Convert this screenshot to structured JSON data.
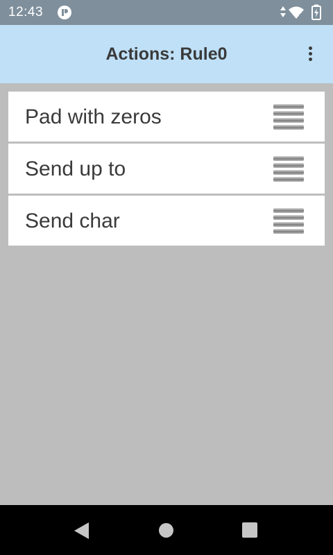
{
  "status_bar": {
    "time": "12:43",
    "icons": [
      "app-notification-icon",
      "data-arrows-icon",
      "wifi-icon",
      "battery-charging-icon"
    ]
  },
  "app_bar": {
    "title": "Actions: Rule0",
    "menu_icon": "overflow-menu-icon"
  },
  "actions": [
    {
      "label": "Pad with zeros"
    },
    {
      "label": "Send up to"
    },
    {
      "label": "Send char"
    }
  ],
  "nav_bar": {
    "icons": [
      "back-icon",
      "home-icon",
      "recents-icon"
    ]
  },
  "colors": {
    "status_bar": "#7f8f9c",
    "app_bar": "#bfe0f7",
    "background": "#bdbdbd",
    "list_item": "#ffffff",
    "text": "#3a3a3a"
  }
}
